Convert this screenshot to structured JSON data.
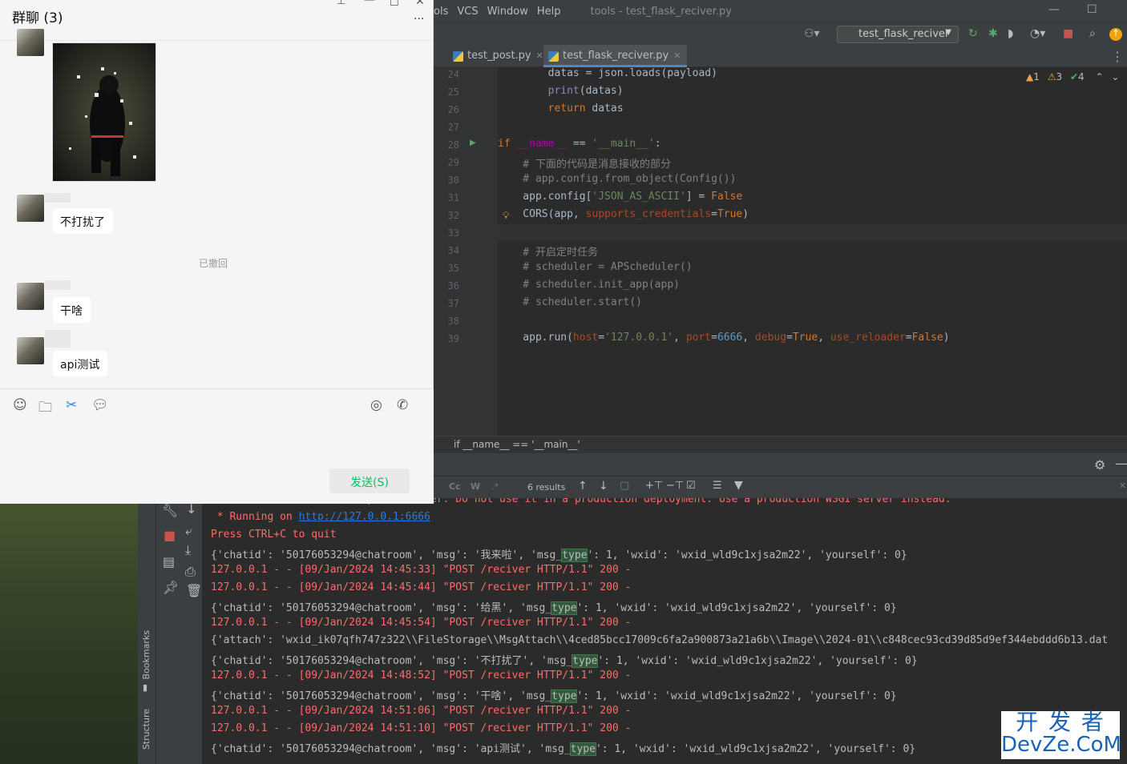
{
  "chat": {
    "title": "群聊 (3)",
    "more": "...",
    "messages": [
      {
        "text": "不打扰了"
      },
      {
        "text": "干啥"
      },
      {
        "text": "api测试"
      }
    ],
    "recalled": "已撤回",
    "send_label": "发送(S)"
  },
  "ide": {
    "menus": [
      "ols",
      "VCS",
      "Window",
      "Help"
    ],
    "window_title": "tools - test_flask_reciver.py",
    "run_config": "test_flask_reciver",
    "tabs": [
      {
        "label": "test_post.py",
        "active": false
      },
      {
        "label": "test_flask_reciver.py",
        "active": true
      }
    ],
    "inspections": {
      "errors": "1",
      "warnings": "3",
      "ok": "4"
    },
    "breadcrumb": "if __name__ == '__main__'",
    "search_results": "6 results",
    "search_flags": [
      "Cc",
      "W",
      ".*"
    ],
    "code_lines": [
      {
        "n": "24",
        "t": "        datas = json.loads(payload)"
      },
      {
        "n": "25",
        "t": "        print(datas)"
      },
      {
        "n": "26",
        "t": "        return datas"
      },
      {
        "n": "27",
        "t": ""
      },
      {
        "n": "28",
        "t": "if __name__ == '__main__':"
      },
      {
        "n": "29",
        "t": "    # 下面的代码是消息接收的部分"
      },
      {
        "n": "30",
        "t": "    # app.config.from_object(Config())"
      },
      {
        "n": "31",
        "t": "    app.config['JSON_AS_ASCII'] = False"
      },
      {
        "n": "32",
        "t": "    CORS(app, supports_credentials=True)"
      },
      {
        "n": "33",
        "t": ""
      },
      {
        "n": "34",
        "t": "    # 开启定时任务"
      },
      {
        "n": "35",
        "t": "    # scheduler = APScheduler()"
      },
      {
        "n": "36",
        "t": "    # scheduler.init_app(app)"
      },
      {
        "n": "37",
        "t": "    # scheduler.start()"
      },
      {
        "n": "38",
        "t": ""
      },
      {
        "n": "39",
        "t": "    app.run(host='127.0.0.1', port=6666, debug=True, use_reloader=False)"
      }
    ],
    "console_lines": [
      {
        "c": "red",
        "t": "WARNING: This is a development server. Do not use it in a production deployment. Use a production WSGI server instead."
      },
      {
        "c": "mix",
        "pre": " * Running on ",
        "link": "http://127.0.0.1:6666"
      },
      {
        "c": "red",
        "t": "Press CTRL+C to quit"
      },
      {
        "c": "hl",
        "a": "{'chatid': '50176053294@chatroom', 'msg': '我来啦', 'msg_",
        "h": "type",
        "b": "': 1, 'wxid': 'wxid_wld9c1xjsa2m22', 'yourself': 0}"
      },
      {
        "c": "red",
        "t": "127.0.0.1 - - [09/Jan/2024 14:45:33] \"POST /reciver HTTP/1.1\" 200 -"
      },
      {
        "c": "red",
        "t": "127.0.0.1 - - [09/Jan/2024 14:45:44] \"POST /reciver HTTP/1.1\" 200 -"
      },
      {
        "c": "hl",
        "a": "{'chatid': '50176053294@chatroom', 'msg': '给黑', 'msg_",
        "h": "type",
        "b": "': 1, 'wxid': 'wxid_wld9c1xjsa2m22', 'yourself': 0}"
      },
      {
        "c": "red",
        "t": "127.0.0.1 - - [09/Jan/2024 14:45:54] \"POST /reciver HTTP/1.1\" 200 -"
      },
      {
        "c": "white",
        "t": "{'attach': 'wxid_ik07qfh747z322\\\\FileStorage\\\\MsgAttach\\\\4ced85bcc17009c6fa2a900873a21a6b\\\\Image\\\\2024-01\\\\c848cec93cd39d85d9ef344ebddd6b13.dat"
      },
      {
        "c": "hl",
        "a": "{'chatid': '50176053294@chatroom', 'msg': '不打扰了', 'msg_",
        "h": "type",
        "b": "': 1, 'wxid': 'wxid_wld9c1xjsa2m22', 'yourself': 0}"
      },
      {
        "c": "red",
        "t": "127.0.0.1 - - [09/Jan/2024 14:48:52] \"POST /reciver HTTP/1.1\" 200 -"
      },
      {
        "c": "hl",
        "a": "{'chatid': '50176053294@chatroom', 'msg': '干啥', 'msg_",
        "h": "type",
        "b": "': 1, 'wxid': 'wxid_wld9c1xjsa2m22', 'yourself': 0}"
      },
      {
        "c": "red",
        "t": "127.0.0.1 - - [09/Jan/2024 14:51:06] \"POST /reciver HTTP/1.1\" 200 -"
      },
      {
        "c": "red",
        "t": "127.0.0.1 - - [09/Jan/2024 14:51:10] \"POST /reciver HTTP/1.1\" 200 -"
      },
      {
        "c": "hl",
        "a": "{'chatid': '50176053294@chatroom', 'msg': 'api测试', 'msg_",
        "h": "type",
        "b": "': 1, 'wxid': 'wxid_wld9c1xjsa2m22', 'yourself': 0}"
      }
    ],
    "side_labels": {
      "bookmarks": "Bookmarks",
      "structure": "Structure"
    }
  },
  "watermark": {
    "line1": "开 发 者",
    "line2": "DevZe.CoM"
  }
}
